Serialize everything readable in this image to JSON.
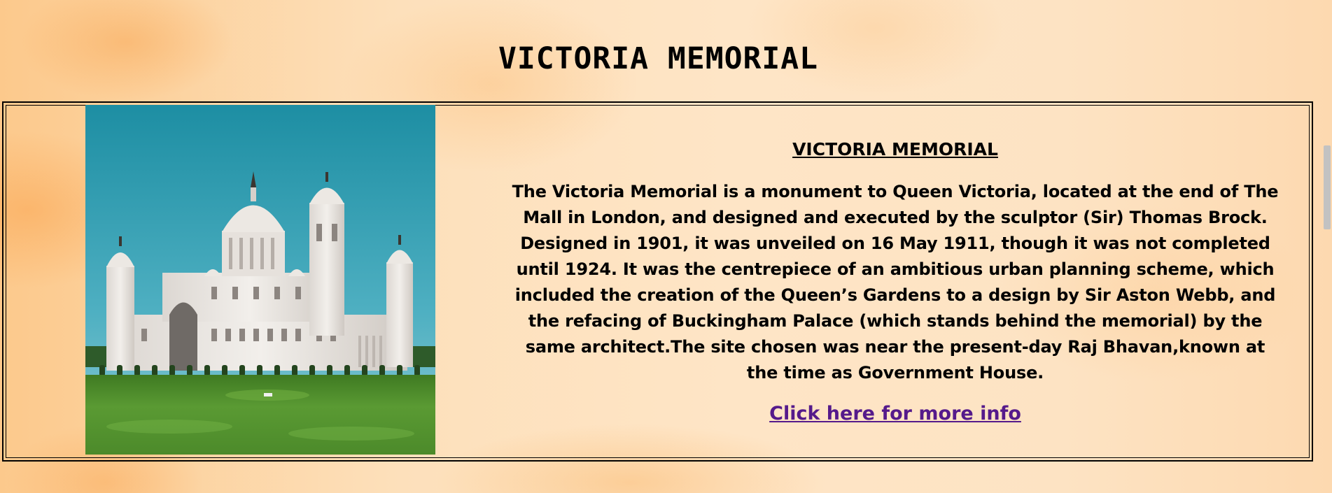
{
  "page": {
    "title": "VICTORIA MEMORIAL"
  },
  "card": {
    "image_alt": "Victoria Memorial building photo",
    "heading": "VICTORIA MEMORIAL",
    "description": "The Victoria Memorial is a monument to Queen Victoria, located at the end of The Mall in London, and designed and executed by the sculptor (Sir) Thomas Brock. Designed in 1901, it was unveiled on 16 May 1911, though it was not completed until 1924. It was the centrepiece of an ambitious urban planning scheme, which included the creation of the Queen’s Gardens to a design by Sir Aston Webb, and the refacing of Buckingham Palace (which stands behind the memorial) by the same architect.The site chosen was near the present-day Raj Bhavan,known at the time as Government House.",
    "link_label": "Click here for more info"
  },
  "colors": {
    "link": "#551a8b",
    "sky": "#2a93a8",
    "grass": "#4f8a2a"
  }
}
